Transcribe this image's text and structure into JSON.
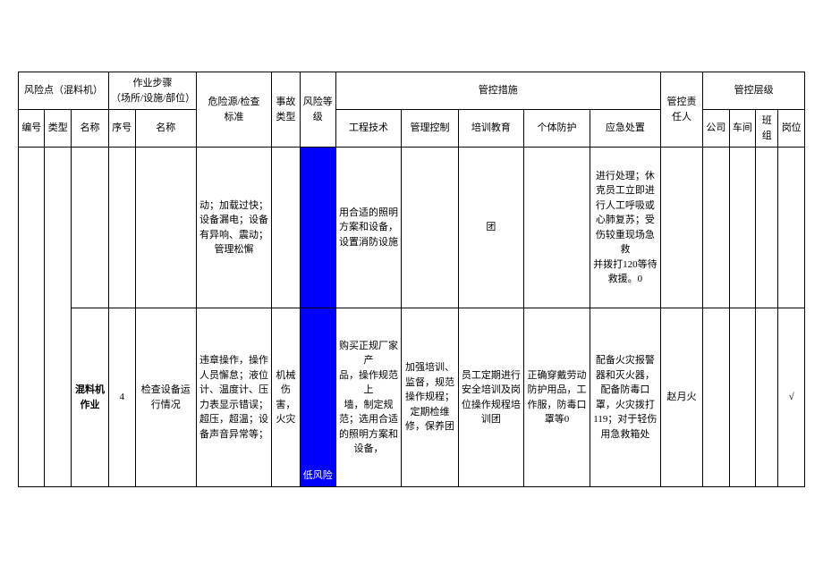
{
  "header": {
    "risk_point": "风险点（混料机）",
    "work_step": "作业步骤\n（场所/设施/部位）",
    "hazard_check": "危险源/检查\n标准",
    "accident_type": "事故\n类型",
    "risk_level": "风险等\n级",
    "control_measures": "管控措施",
    "responsible": "管控责任人",
    "control_level": "管控层级",
    "number": "编号",
    "type": "类型",
    "name": "名称",
    "step_no": "序号",
    "step_name": "名称",
    "engineering": "工程技术",
    "management": "管理控制",
    "training": "培训教育",
    "ppe": "个体防护",
    "emergency": "应急处置",
    "company": "公司",
    "workshop": "车间",
    "team": "班\n组",
    "position": "岗位"
  },
  "rows": [
    {
      "hazard": "动；加载过快；设备漏电；设备有异响、震动；管理松懈",
      "engineering": "用合适的照明方案和设备，设置消防设施",
      "training_col": "团",
      "emergency": "进行处理；休克员工立即进行人工呼吸或心肺复苏；受伤较重现场急救\n并拨打120等待救援。0"
    },
    {
      "name": "混料机作业",
      "step_no": "4",
      "step_name": "检查设备运行情况",
      "hazard": "违章操作，操作人员懈怠；液位计、温度计、压力表显示错误；超压，超温；设备声音异常等；",
      "accident": "机械伤害，火灾",
      "risk_level": "低风险",
      "engineering": "购买正规厂家产\n品，操作规范上\n墙，制定规\n范；选用合适的照明方案和设备，",
      "management": "加强培训、监督，规范操作规程；定期检维修，保养团",
      "training": "员工定期进行安全培训及岗位操作规程培训团",
      "ppe": "正确穿戴劳动防护用品，工作服，防毒口罩等0",
      "emergency": "配备火灾报警器和灭火器，配备防毒口罩，火灾拨打\n119；对于轻伤用急救箱处",
      "responsible": "赵月火",
      "position": "√"
    }
  ]
}
